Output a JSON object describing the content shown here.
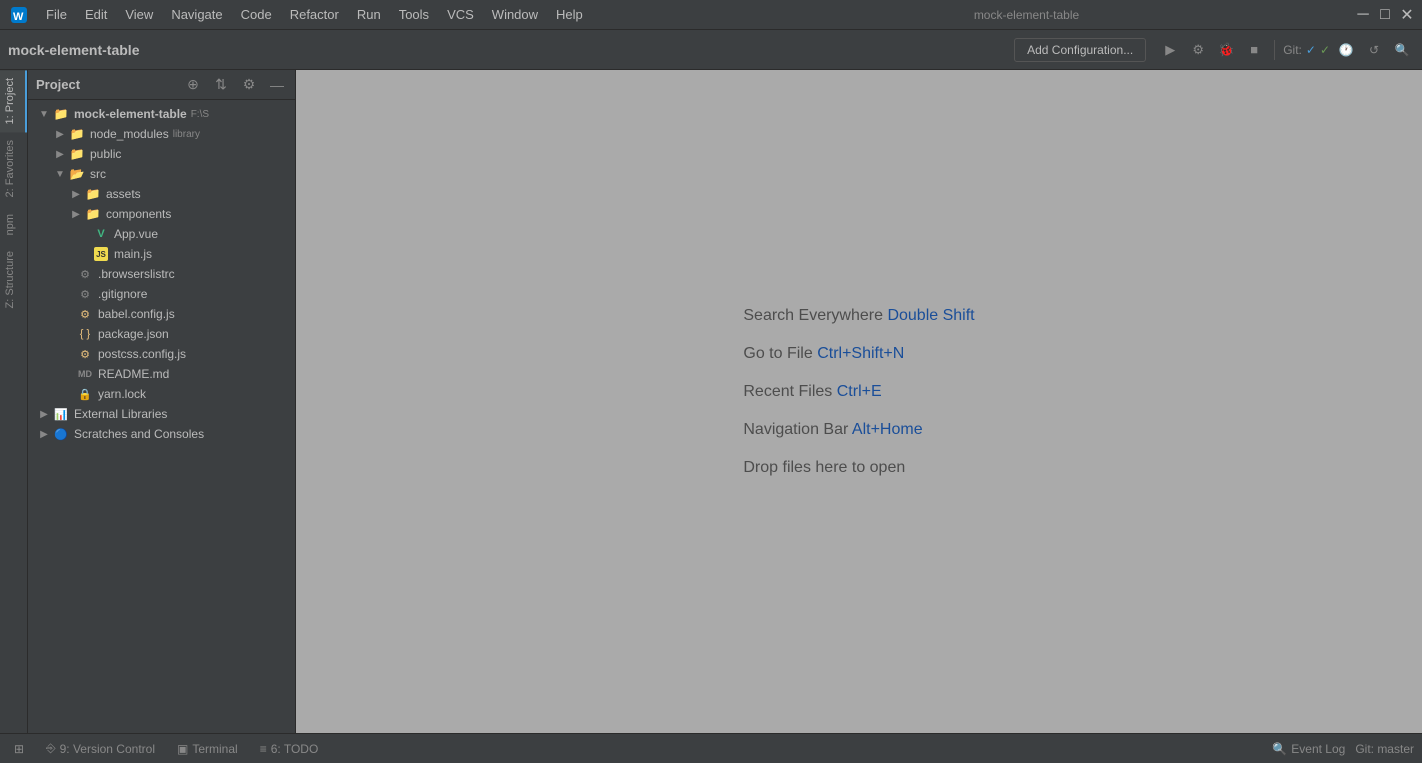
{
  "titleBar": {
    "projectName": "mock-element-table",
    "menus": [
      "File",
      "Edit",
      "View",
      "Navigate",
      "Code",
      "Refactor",
      "Run",
      "Tools",
      "VCS",
      "Window",
      "Help"
    ],
    "windowTitle": "mock-element-table",
    "windowControls": [
      "—",
      "□",
      "×"
    ]
  },
  "toolbar": {
    "projectLabel": "mock-element-table",
    "addConfigLabel": "Add Configuration...",
    "gitLabel": "Git:",
    "gitBranch": "master"
  },
  "projectPanel": {
    "title": "Project",
    "rootItem": "mock-element-table",
    "rootPath": "F:\\S",
    "items": [
      {
        "id": "node_modules",
        "label": "node_modules",
        "badge": "library",
        "type": "folder",
        "depth": 1,
        "collapsed": true
      },
      {
        "id": "public",
        "label": "public",
        "type": "folder",
        "depth": 1,
        "collapsed": true
      },
      {
        "id": "src",
        "label": "src",
        "type": "folder",
        "depth": 1,
        "collapsed": false
      },
      {
        "id": "assets",
        "label": "assets",
        "type": "folder",
        "depth": 2,
        "collapsed": true
      },
      {
        "id": "components",
        "label": "components",
        "type": "folder",
        "depth": 2,
        "collapsed": true
      },
      {
        "id": "App.vue",
        "label": "App.vue",
        "type": "vue",
        "depth": 3
      },
      {
        "id": "main.js",
        "label": "main.js",
        "type": "js",
        "depth": 3
      },
      {
        "id": ".browserslistrc",
        "label": ".browserslistrc",
        "type": "config",
        "depth": 2
      },
      {
        "id": ".gitignore",
        "label": ".gitignore",
        "type": "git",
        "depth": 2
      },
      {
        "id": "babel.config.js",
        "label": "babel.config.js",
        "type": "js-config",
        "depth": 2
      },
      {
        "id": "package.json",
        "label": "package.json",
        "type": "json",
        "depth": 2
      },
      {
        "id": "postcss.config.js",
        "label": "postcss.config.js",
        "type": "js-config",
        "depth": 2
      },
      {
        "id": "README.md",
        "label": "README.md",
        "type": "md",
        "depth": 2
      },
      {
        "id": "yarn.lock",
        "label": "yarn.lock",
        "type": "lock",
        "depth": 2
      }
    ],
    "externalLibraries": "External Libraries",
    "scratchesConsoles": "Scratches and Consoles"
  },
  "editorArea": {
    "hints": [
      {
        "text": "Search Everywhere",
        "shortcut": "Double Shift"
      },
      {
        "text": "Go to File",
        "shortcut": "Ctrl+Shift+N"
      },
      {
        "text": "Recent Files",
        "shortcut": "Ctrl+E"
      },
      {
        "text": "Navigation Bar",
        "shortcut": "Alt+Home"
      },
      {
        "text": "Drop files here to open",
        "shortcut": ""
      }
    ]
  },
  "sideTabsLeft": [
    {
      "label": "1: Project",
      "active": true
    },
    {
      "label": "2: Favorites"
    },
    {
      "label": "npm"
    },
    {
      "label": "Z: Structure"
    }
  ],
  "bottomBar": {
    "tabs": [
      {
        "icon": "⎆",
        "label": "9: Version Control"
      },
      {
        "icon": "▣",
        "label": "Terminal"
      },
      {
        "icon": "≡",
        "label": "6: TODO"
      }
    ],
    "eventLog": "Event Log",
    "gitStatus": "Git: master"
  }
}
